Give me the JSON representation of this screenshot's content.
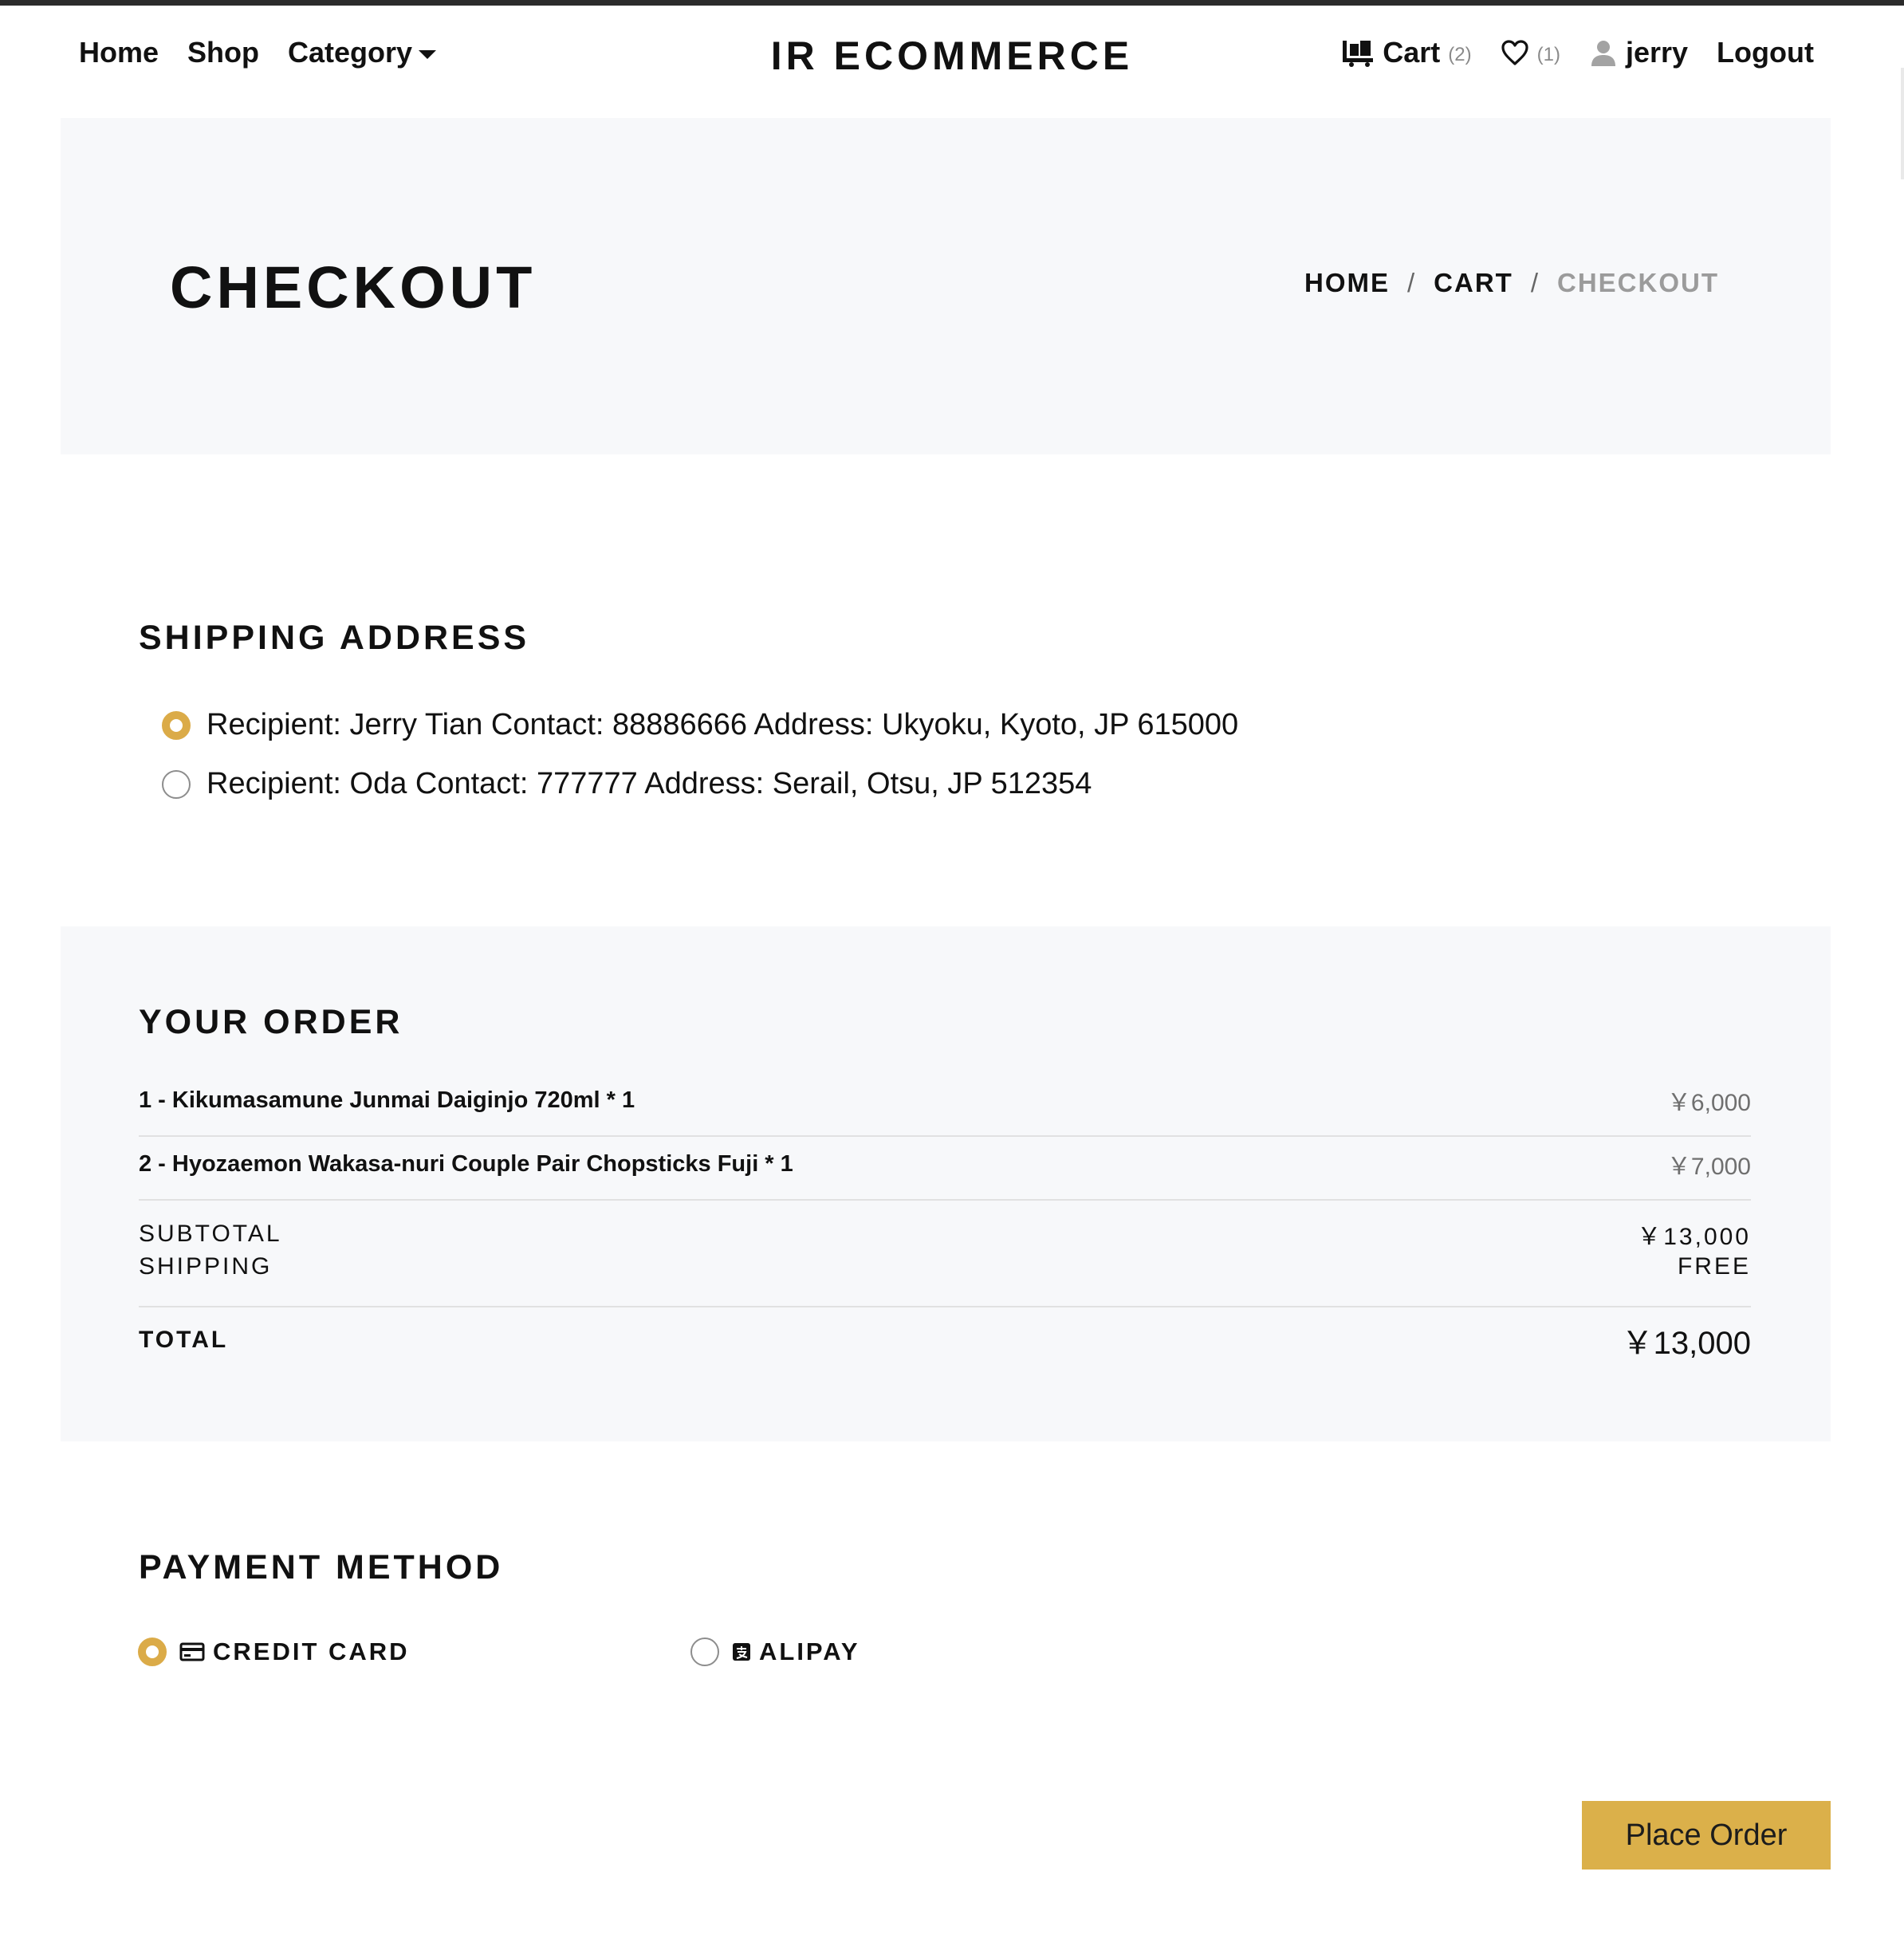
{
  "header": {
    "nav": [
      {
        "label": "Home"
      },
      {
        "label": "Shop"
      },
      {
        "label": "Category"
      }
    ],
    "brand": "IR ECOMMERCE",
    "cart": {
      "label": "Cart",
      "count": "(2)"
    },
    "wishlist": {
      "count": "(1)"
    },
    "user": {
      "name": "jerry"
    },
    "logout": "Logout"
  },
  "hero": {
    "title": "CHECKOUT",
    "breadcrumb": {
      "home": "HOME",
      "sep": "/",
      "cart": "CART",
      "current": "CHECKOUT"
    }
  },
  "shipping": {
    "title": "SHIPPING ADDRESS",
    "addresses": [
      {
        "text": "Recipient: Jerry Tian Contact: 88886666 Address: Ukyoku, Kyoto, JP 615000",
        "selected": true
      },
      {
        "text": "Recipient: Oda Contact: 777777 Address: Serail, Otsu, JP 512354",
        "selected": false
      }
    ]
  },
  "order": {
    "title": "YOUR ORDER",
    "items": [
      {
        "name": "1 - Kikumasamune Junmai Daiginjo 720ml * 1",
        "price": "￥6,000"
      },
      {
        "name": "2 - Hyozaemon Wakasa-nuri Couple Pair Chopsticks Fuji * 1",
        "price": "￥7,000"
      }
    ],
    "subtotal_label": "SUBTOTAL",
    "subtotal_value": "￥13,000",
    "shipping_label": "SHIPPING",
    "shipping_value": "FREE",
    "total_label": "TOTAL",
    "total_value": "￥13,000"
  },
  "payment": {
    "title": "PAYMENT METHOD",
    "options": [
      {
        "label": "CREDIT CARD",
        "icon": "credit-card-icon",
        "selected": true
      },
      {
        "label": "ALIPAY",
        "icon": "alipay-icon",
        "selected": false
      }
    ]
  },
  "actions": {
    "place_order": "Place Order"
  },
  "colors": {
    "accent": "#dbab48",
    "panel": "#f7f8fa",
    "button": "#dbb04a"
  }
}
